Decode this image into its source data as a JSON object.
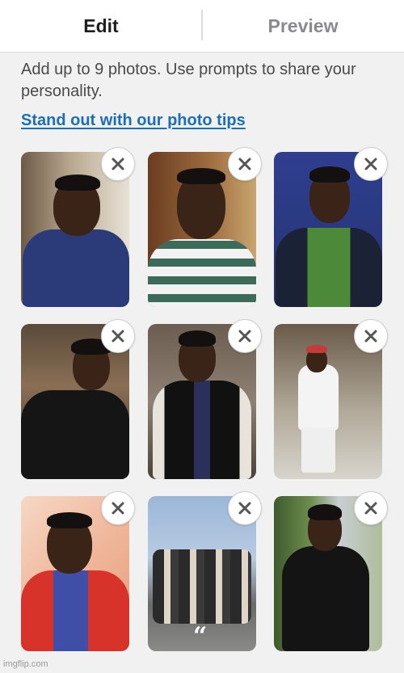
{
  "tabs": [
    {
      "label": "Edit",
      "active": true
    },
    {
      "label": "Preview",
      "active": false
    }
  ],
  "intro_text": "Add up to 9 photos. Use prompts to share your personality.",
  "tips_link": "Stand out with our photo tips",
  "colors": {
    "link": "#1a6fb6",
    "active_tab": "#1f1f1f",
    "inactive_tab": "#8a8a8e",
    "background": "#f1f1f2"
  },
  "photos": [
    {
      "id": 1,
      "remove_icon": "close-icon"
    },
    {
      "id": 2,
      "remove_icon": "close-icon"
    },
    {
      "id": 3,
      "remove_icon": "close-icon"
    },
    {
      "id": 4,
      "remove_icon": "close-icon"
    },
    {
      "id": 5,
      "remove_icon": "close-icon"
    },
    {
      "id": 6,
      "remove_icon": "close-icon"
    },
    {
      "id": 7,
      "remove_icon": "close-icon"
    },
    {
      "id": 8,
      "remove_icon": "close-icon",
      "prompt_icon": "quote-icon",
      "prompt_glyph": "“"
    },
    {
      "id": 9,
      "remove_icon": "close-icon"
    }
  ],
  "watermark": "imgflip.com"
}
